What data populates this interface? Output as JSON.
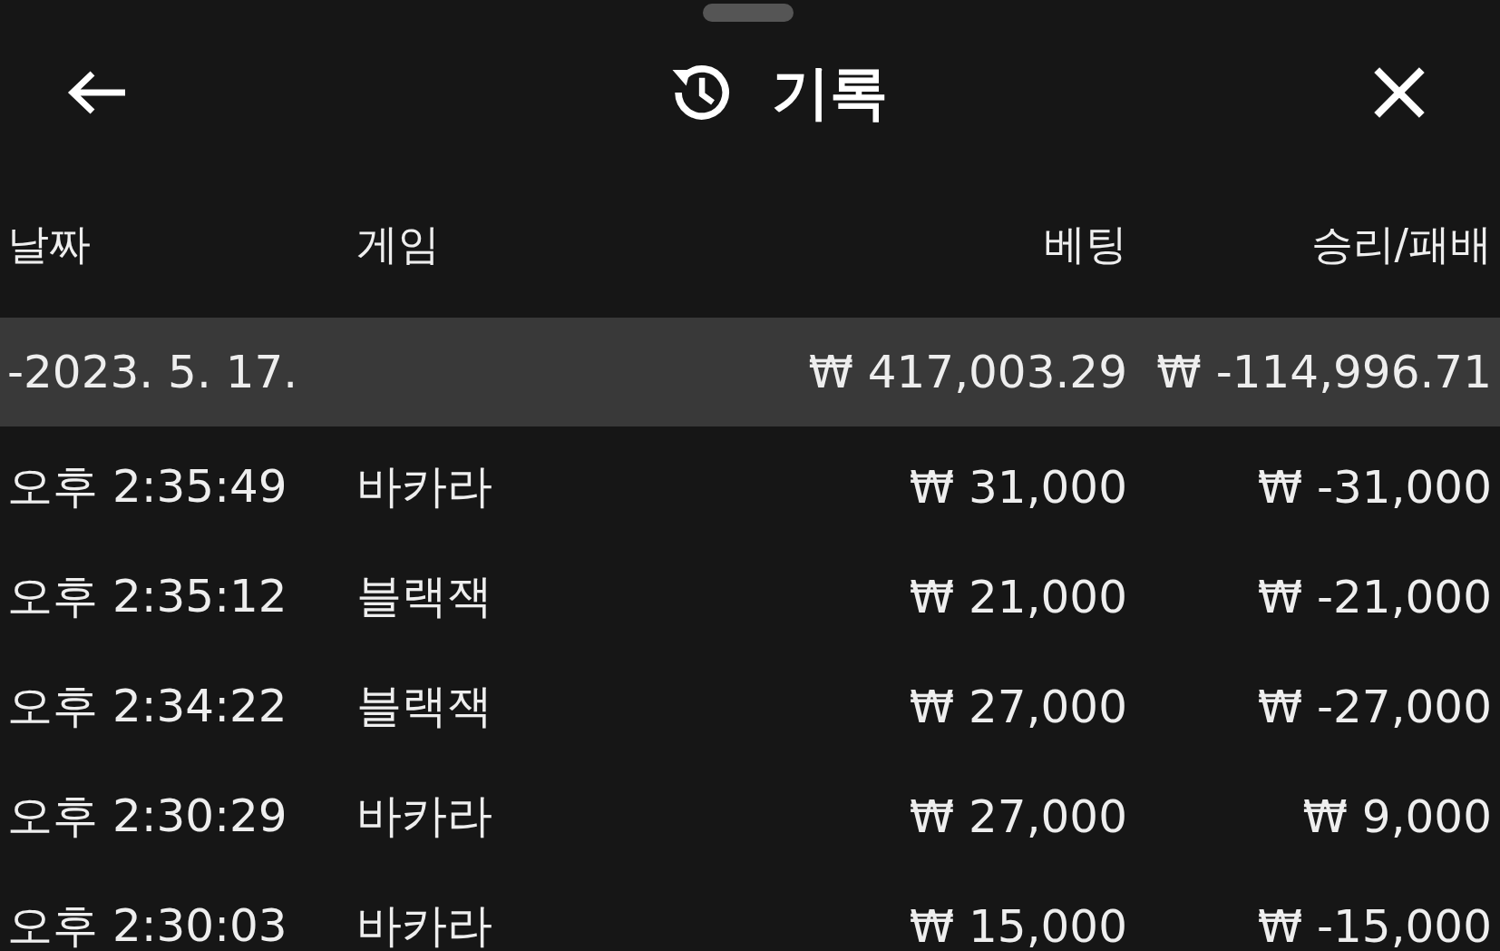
{
  "header": {
    "title": "기록"
  },
  "columns": [
    "날짜",
    "게임",
    "베팅",
    "승리/패배"
  ],
  "groups": [
    {
      "date": "-2023. 5. 17.",
      "bet": "₩ 417,003.29",
      "result": "₩ -114,996.71",
      "rows": [
        {
          "time": "오후 2:35:49",
          "game": "바카라",
          "bet": "₩ 31,000",
          "result": "₩ -31,000"
        },
        {
          "time": "오후 2:35:12",
          "game": "블랙잭",
          "bet": "₩ 21,000",
          "result": "₩ -21,000"
        },
        {
          "time": "오후 2:34:22",
          "game": "블랙잭",
          "bet": "₩ 27,000",
          "result": "₩ -27,000"
        },
        {
          "time": "오후 2:30:29",
          "game": "바카라",
          "bet": "₩ 27,000",
          "result": "₩ 9,000"
        },
        {
          "time": "오후 2:30:03",
          "game": "바카라",
          "bet": "₩ 15,000",
          "result": "₩ -15,000"
        }
      ]
    }
  ]
}
